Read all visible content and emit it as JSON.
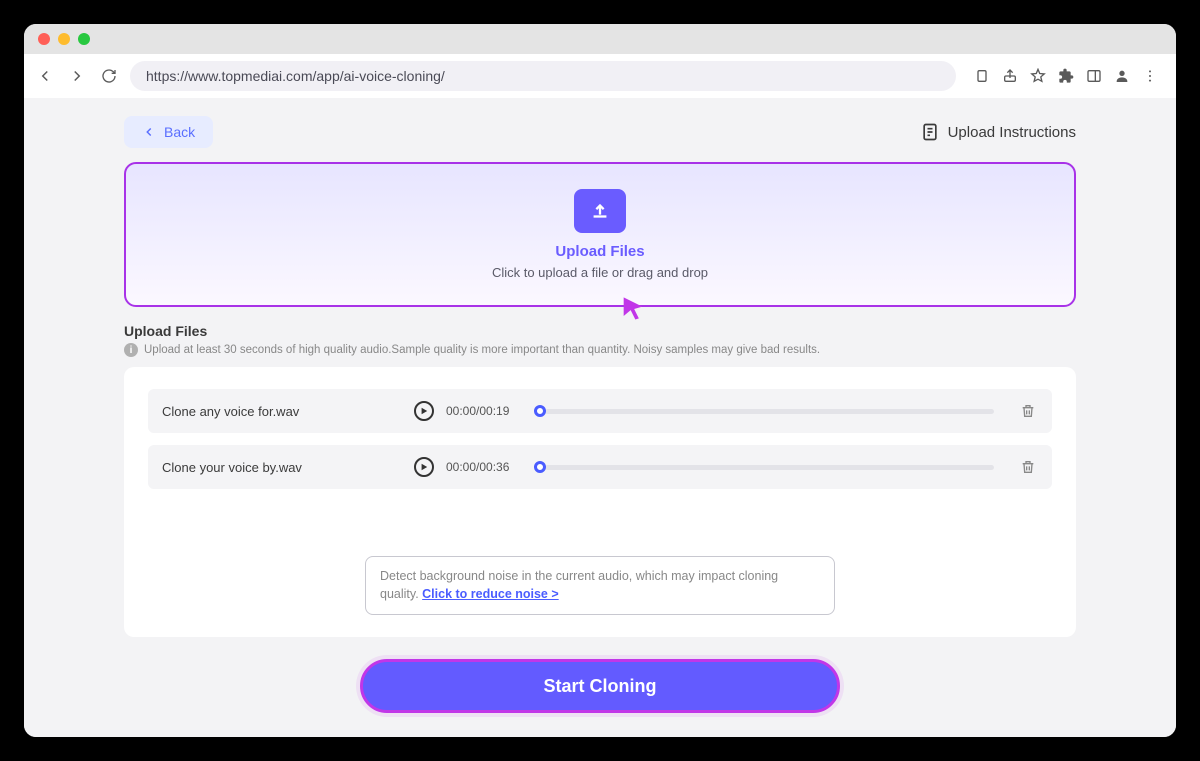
{
  "browser": {
    "url": "https://www.topmediai.com/app/ai-voice-cloning/"
  },
  "back_label": "Back",
  "instructions_label": "Upload Instructions",
  "upload_zone": {
    "title": "Upload Files",
    "sub": "Click to upload a file or drag and drop"
  },
  "section": {
    "label": "Upload Files",
    "help": "Upload at least 30 seconds of high quality audio.Sample quality is more important than quantity. Noisy samples may give bad results."
  },
  "files": [
    {
      "name": "Clone any voice for.wav",
      "time": "00:00/00:19"
    },
    {
      "name": "Clone your voice by.wav",
      "time": "00:00/00:36"
    }
  ],
  "noise": {
    "text": "Detect background noise in the current audio, which may impact cloning quality. ",
    "link": "Click to reduce noise >"
  },
  "start_label": "Start Cloning"
}
